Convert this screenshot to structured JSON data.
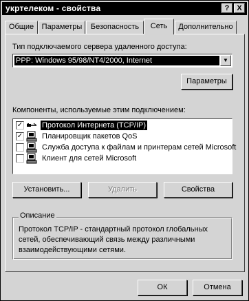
{
  "window": {
    "title": "укртелеком - свойства",
    "help_label": "?",
    "close_label": "X"
  },
  "tabs": [
    {
      "label": "Общие"
    },
    {
      "label": "Параметры"
    },
    {
      "label": "Безопасность"
    },
    {
      "label": "Сеть",
      "active": true
    },
    {
      "label": "Дополнительно"
    }
  ],
  "server_type": {
    "label": "Тип подключаемого сервера удаленного доступа:",
    "selected": "PPP: Windows 95/98/NT4/2000, Internet",
    "settings_button": "Параметры"
  },
  "components": {
    "label": "Компоненты, используемые этим подключением:",
    "items": [
      {
        "label": "Протокол Интернета (TCP/IP)",
        "checked": true,
        "icon": "network-cable-icon",
        "selected": true
      },
      {
        "label": "Планировщик пакетов QoS",
        "checked": true,
        "icon": "computer-icon",
        "selected": false
      },
      {
        "label": "Служба доступа к файлам и принтерам сетей Microsoft",
        "checked": false,
        "icon": "computer-icon",
        "selected": false
      },
      {
        "label": "Клиент для сетей Microsoft",
        "checked": false,
        "icon": "computer-icon",
        "selected": false
      }
    ]
  },
  "actions": {
    "install": "Установить...",
    "remove": "Удалить",
    "properties": "Свойства"
  },
  "description": {
    "legend": "Описание",
    "text": "Протокол TCP/IP - стандартный протокол глобальных сетей, обеспечивающий связь между различными взаимодействующими сетями."
  },
  "footer": {
    "ok": "ОК",
    "cancel": "Отмена"
  },
  "colors": {
    "face": "#d4d4d4",
    "titlebar": "#000000",
    "selection": "#000000"
  }
}
